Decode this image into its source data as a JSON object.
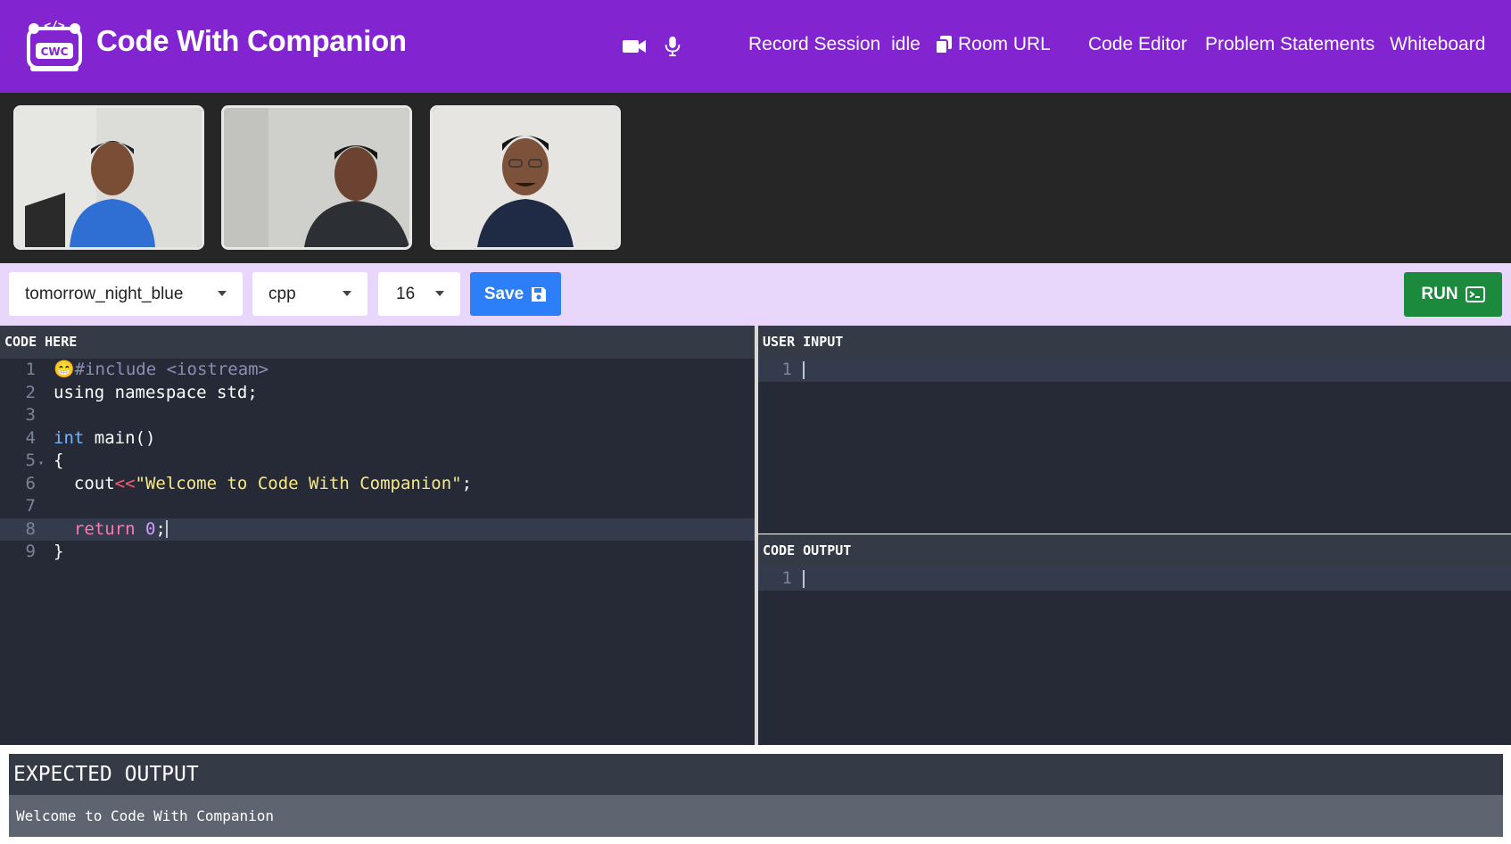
{
  "header": {
    "app_title": "Code With Companion",
    "logo_text": "CWC",
    "record_label": "Record Session",
    "record_status": "idle",
    "room_url_label": "Room URL",
    "nav_items": [
      "Code Editor",
      "Problem Statements",
      "Whiteboard"
    ],
    "background": "#8224d0"
  },
  "videos": [
    {
      "participant": "participant-1"
    },
    {
      "participant": "participant-2"
    },
    {
      "participant": "participant-3"
    }
  ],
  "toolbar": {
    "theme_value": "tomorrow_night_blue",
    "language_value": "cpp",
    "font_size_value": "16",
    "save_label": "Save",
    "run_label": "RUN"
  },
  "code_pane": {
    "header": "CODE HERE",
    "line_numbers": [
      "1",
      "2",
      "3",
      "4",
      "5",
      "6",
      "7",
      "8",
      "9"
    ],
    "active_line": 8
  },
  "input_pane": {
    "header": "USER INPUT",
    "line_numbers": [
      "1"
    ]
  },
  "output_pane": {
    "header": "CODE OUTPUT",
    "line_numbers": [
      "1"
    ]
  },
  "expected_output": {
    "header": "EXPECTED OUTPUT",
    "text": "Welcome to Code With Companion"
  },
  "code_tokens": {
    "l1_emoji": "😁",
    "l1_include": "#include <iostream>",
    "l2_text": "using namespace std;",
    "l4_kw": "int",
    "l4_rest": " main()",
    "l5_text": "{",
    "l6_indent": "  ",
    "l6_cout": "cout",
    "l6_op": "<<",
    "l6_str": "\"Welcome to Code With Companion\"",
    "l6_end": ";",
    "l8_indent": "  ",
    "l8_kw": "return",
    "l8_num": " 0",
    "l8_end": ";",
    "l9_text": "}"
  },
  "colors": {
    "accent_purple": "#8224d0",
    "toolbar_bg": "#e9d7fb",
    "save_blue": "#2d7ff9",
    "run_green": "#1b8a3c",
    "editor_bg": "#252a36"
  },
  "icons": {
    "video": "video-camera-icon",
    "mic": "microphone-icon",
    "copy": "copy-icon",
    "save": "floppy-disk-icon",
    "run": "terminal-icon"
  }
}
